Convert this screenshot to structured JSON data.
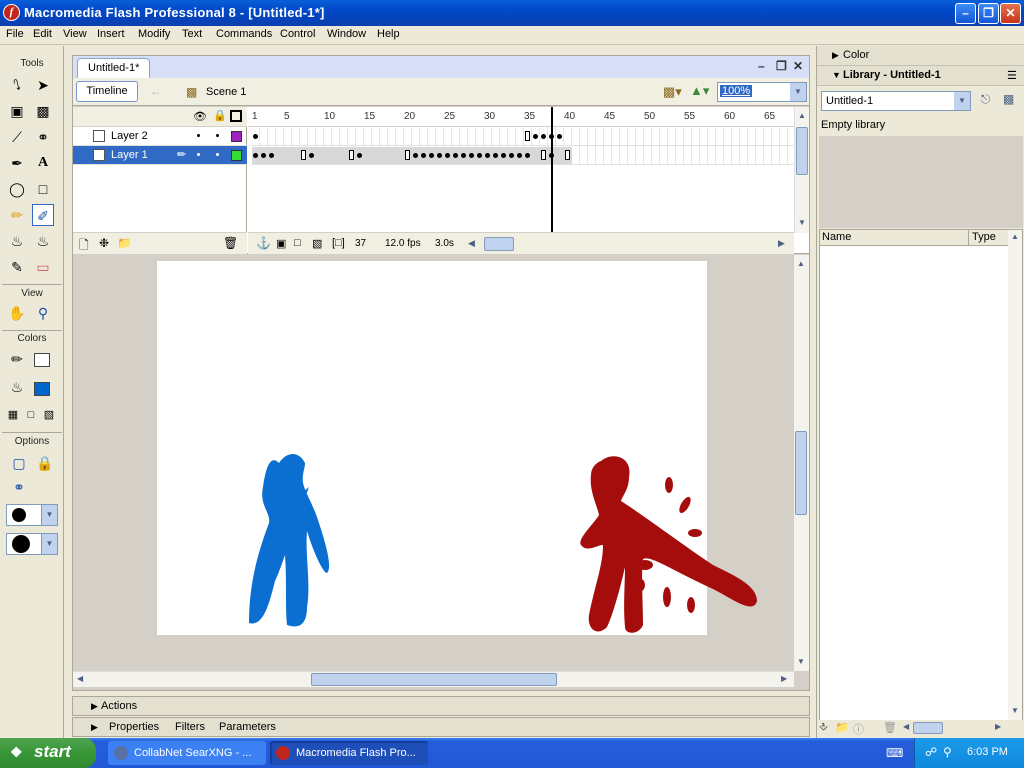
{
  "window": {
    "title": "Macromedia Flash Professional 8 - [Untitled-1*]",
    "app_icon": "flash-f-icon",
    "icon_letter": "f"
  },
  "menu": [
    "File",
    "Edit",
    "View",
    "Insert",
    "Modify",
    "Text",
    "Commands",
    "Control",
    "Window",
    "Help"
  ],
  "tools": {
    "header": "Tools",
    "view_header": "View",
    "colors_header": "Colors",
    "options_header": "Options",
    "items": [
      "arrow-tool",
      "subselect-tool",
      "free-transform-tool",
      "fill-transform-tool",
      "line-tool",
      "lasso-tool",
      "pen-tool",
      "text-tool",
      "oval-tool",
      "rectangle-tool",
      "pencil-tool",
      "brush-tool",
      "ink-bottle-tool",
      "paint-bucket-tool",
      "eyedropper-tool",
      "eraser-tool"
    ],
    "selected": "brush-tool",
    "stroke_color": "#ffffff",
    "fill_color": "#0066cc"
  },
  "document": {
    "tab": "Untitled-1*",
    "timeline_button": "Timeline",
    "scene": "Scene 1",
    "zoom": "100%"
  },
  "timeline": {
    "layers": [
      {
        "name": "Layer 2",
        "color": "#a020c0",
        "selected": false
      },
      {
        "name": "Layer 1",
        "color": "#33dd33",
        "selected": true
      }
    ],
    "ruler": [
      "1",
      "5",
      "10",
      "15",
      "20",
      "25",
      "30",
      "35",
      "40",
      "45",
      "50",
      "55",
      "60",
      "65"
    ],
    "current_frame": "37",
    "fps": "12.0 fps",
    "time": "3.0s"
  },
  "stage": {
    "blue_figure_color": "#0a6fd1",
    "red_figure_color": "#a50d0d"
  },
  "panels": {
    "actions": "Actions",
    "properties": "Properties",
    "filters": "Filters",
    "parameters": "Parameters"
  },
  "right": {
    "color_header": "Color",
    "library_header": "Library - Untitled-1",
    "library_select": "Untitled-1",
    "empty_text": "Empty library",
    "col_name": "Name",
    "col_type": "Type"
  },
  "taskbar": {
    "start": "start",
    "items": [
      {
        "label": "CollabNet SearXNG - ...",
        "icon": "browser-icon",
        "active": false
      },
      {
        "label": "Macromedia Flash Pro...",
        "icon": "flash-icon",
        "active": true
      }
    ],
    "clock": "6:03 PM"
  }
}
